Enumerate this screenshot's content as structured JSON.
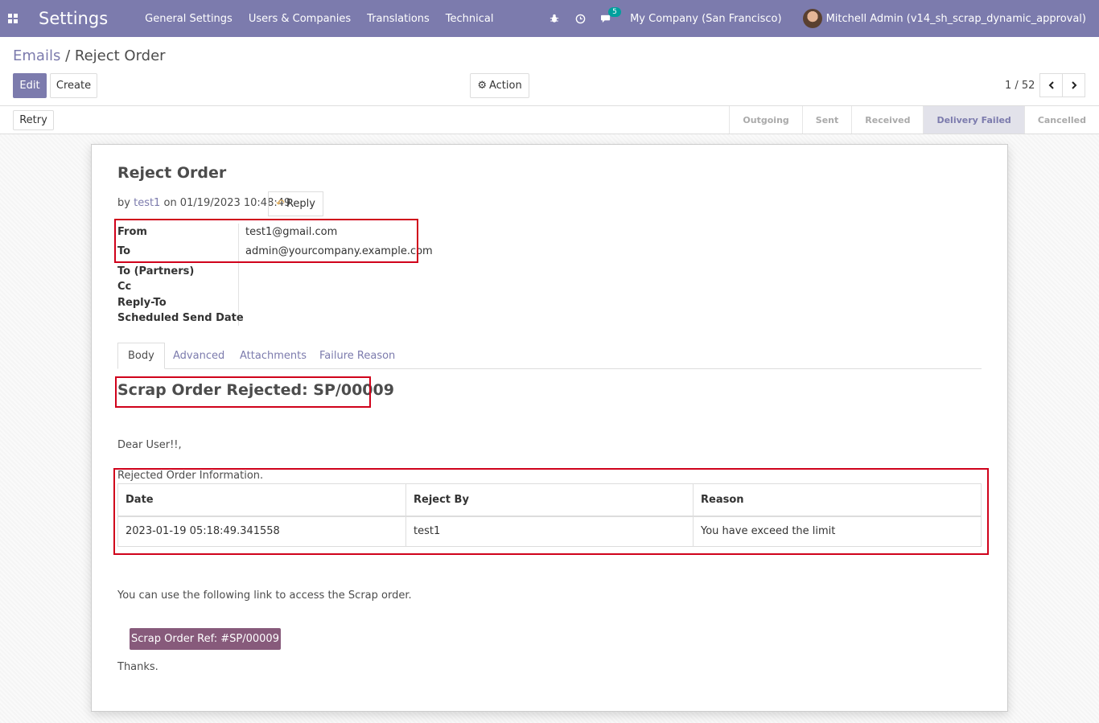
{
  "navbar": {
    "app_title": "Settings",
    "menu": [
      "General Settings",
      "Users & Companies",
      "Translations",
      "Technical"
    ],
    "messages_count": "5",
    "company": "My Company (San Francisco)",
    "user": "Mitchell Admin (v14_sh_scrap_dynamic_approval)"
  },
  "control_panel": {
    "breadcrumb_parent": "Emails",
    "breadcrumb_sep": "/",
    "breadcrumb_current": "Reject Order",
    "edit_label": "Edit",
    "create_label": "Create",
    "action_label": "Action",
    "pager": "1 / 52"
  },
  "statusbar": {
    "retry_label": "Retry",
    "stages": [
      "Outgoing",
      "Sent",
      "Received",
      "Delivery Failed",
      "Cancelled"
    ],
    "active_stage": "Delivery Failed"
  },
  "message": {
    "title": "Reject Order",
    "by_prefix": "by",
    "author": "test1",
    "on_date": "on 01/19/2023 10:48:49",
    "reply_label": "Reply",
    "fields": {
      "from_label": "From",
      "from_value": "test1@gmail.com",
      "to_label": "To",
      "to_value": "admin@yourcompany.example.com",
      "to_partners_label": "To (Partners)",
      "cc_label": "Cc",
      "reply_to_label": "Reply-To",
      "scheduled_label": "Scheduled Send Date"
    }
  },
  "tabs": [
    "Body",
    "Advanced",
    "Attachments",
    "Failure Reason"
  ],
  "body": {
    "heading": "Scrap Order Rejected: SP/00009",
    "greeting": "Dear User!!,",
    "info_caption": "Rejected Order Information.",
    "table": {
      "headers": [
        "Date",
        "Reject By",
        "Reason"
      ],
      "row": [
        "2023-01-19 05:18:49.341558",
        "test1",
        "You have exceed the limit"
      ]
    },
    "link_text": "You can use the following link to access the Scrap order.",
    "ref_button": "Scrap Order Ref: #SP/00009",
    "thanks": "Thanks."
  }
}
